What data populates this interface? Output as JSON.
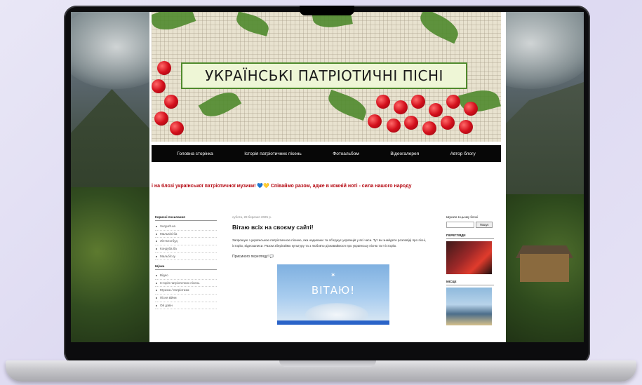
{
  "blog": {
    "title": "УКРАЇНСЬКІ ПАТРІОТИЧНІ ПІСНІ",
    "nav": [
      "Головна сторінка",
      "Історія патріотичних пісень",
      "Фотоальбом",
      "Відеогалерея",
      "Автор блогу"
    ],
    "marquee": {
      "text_before": "і на блозі української патріотичної музики!",
      "heart_blue": "💙",
      "heart_yellow": "💛",
      "text_after": "Співаймо разом, адже в кожній ноті - сила нашого народу"
    }
  },
  "sidebar_left": {
    "widget1_title": "Корисні посилання",
    "links": [
      "Surgurlt.ua",
      "Мальвіні.ба",
      "Ліп-Блогбуд",
      "Кондуба.ба",
      "Мальбіт.ку"
    ],
    "widget2_title": "Щічка",
    "labels": [
      "Відео",
      "Історія патріотичних пісень",
      "Музика / патріотизм",
      "Пісня війни",
      "Ой дзвін"
    ]
  },
  "post": {
    "date": "субота, 28 березня 2025 р.",
    "title": "Вітаю всіх на своєму сайті!",
    "body": "Запрошую з українською патріотичною піснею, яка надихаює та об'єднує українців у всі часи. Тут ви знайдете розповіді про пісні, історію, відеозаписи. Разом зберігаймо культуру та з любов'ю дізнаваймося про українську пісню та її історію.",
    "signature": "Приємного перегляду!",
    "signature_icon": "💬",
    "image_text": "ВІТАЮ!"
  },
  "sidebar_right": {
    "search_label": "Шукати в цьому блозі",
    "search_button": "Пошук",
    "widget1_title": "ПЕРЕГЛЯДИ",
    "widget2_title": "МІСЦЕ"
  }
}
